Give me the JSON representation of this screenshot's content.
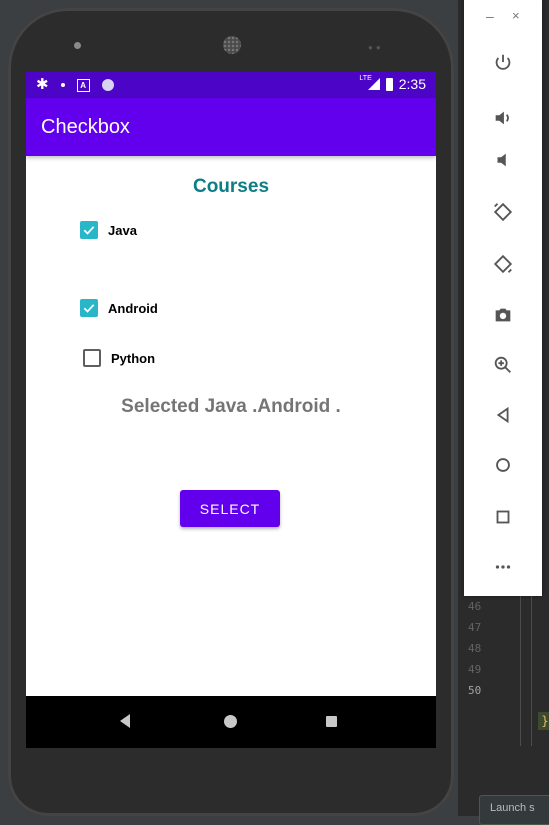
{
  "statusbar": {
    "time": "2:35",
    "network": "LTE"
  },
  "appbar": {
    "title": "Checkbox"
  },
  "content": {
    "heading": "Courses",
    "checkboxes": [
      {
        "label": "Java",
        "checked": true
      },
      {
        "label": "Android",
        "checked": true
      },
      {
        "label": "Python",
        "checked": false
      }
    ],
    "selected_text": "Selected Java .Android .",
    "select_button": "SELECT"
  },
  "emulator_panel": {
    "minimize": "–",
    "close": "×",
    "buttons": [
      "power-icon",
      "volume-up-icon",
      "volume-down-icon",
      "rotate-left-icon",
      "rotate-right-icon",
      "camera-icon",
      "zoom-icon",
      "back-icon",
      "home-icon",
      "overview-icon",
      "more-icon"
    ]
  },
  "ide": {
    "line_numbers": [
      "46",
      "47",
      "48",
      "49",
      "50"
    ],
    "brace": "}",
    "launch_label": "Launch s"
  },
  "colors": {
    "primary": "#6200ee",
    "status": "#4c05c6",
    "accent": "#29b6c9",
    "heading": "#0d7e86"
  }
}
